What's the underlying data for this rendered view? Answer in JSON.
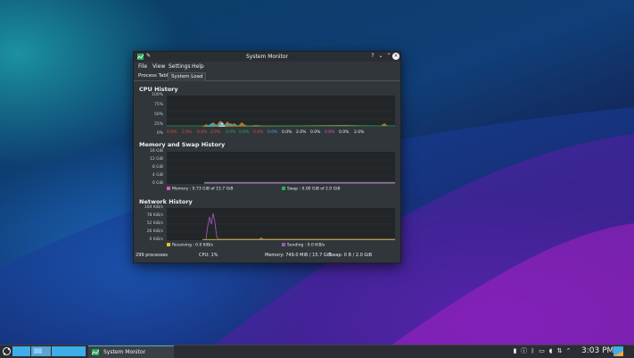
{
  "window": {
    "title": "System Monitor",
    "buttons": {
      "help": "?",
      "minimize": "⌄",
      "maximize": "⌃",
      "close": "×"
    }
  },
  "menu": [
    "File",
    "View",
    "Settings",
    "Help"
  ],
  "tabs": [
    {
      "label": "Process Table",
      "active": false
    },
    {
      "label": "System Load",
      "active": true
    }
  ],
  "cpu": {
    "title": "CPU History",
    "y_ticks": [
      "100%",
      "75%",
      "50%",
      "25%",
      "0%"
    ],
    "legend_values": [
      "0.0%",
      "2.0%",
      "0.0%",
      "2.0%",
      "0.0%",
      "0.0%",
      "0.0%",
      "0.0%",
      "0.0%",
      "2.0%",
      "0.0%",
      "0.0%",
      "0.0%",
      "2.0%"
    ],
    "legend_colors": [
      "#e74c3c",
      "#e74c3c",
      "#e74c3c",
      "#e74c3c",
      "#27ae60",
      "#27ae60",
      "#e74c3c",
      "#3daee9",
      "#eff0f1",
      "#eff0f1",
      "#eff0f1",
      "#e056c8",
      "#eff0f1",
      "#eff0f1"
    ]
  },
  "memory": {
    "title": "Memory and Swap History",
    "y_ticks": [
      "16 GiB",
      "12 GiB",
      "8 GiB",
      "4 GiB",
      "0 GiB"
    ],
    "memory_legend": "Memory : 0.73 GiB of 15.7 GiB",
    "swap_legend": "Swap : 0.00 GiB of 2.0 GiB",
    "memory_color": "#e056c8",
    "swap_color": "#27ae60"
  },
  "network": {
    "title": "Network History",
    "y_ticks": [
      "104 KiB/s",
      "78 KiB/s",
      "52 KiB/s",
      "26 KiB/s",
      "0 KiB/s"
    ],
    "receiving_legend": "Receiving : 0.0 KiB/s",
    "sending_legend": "Sending : 0.0 KiB/s",
    "receiving_color": "#d4c82a",
    "sending_color": "#9b59b6"
  },
  "status": {
    "processes": "299 processes",
    "cpu": "CPU: 1%",
    "memory": "Memory: 749.0 MiB / 15.7 GiB",
    "swap": "Swap: 0 B / 2.0 GiB"
  },
  "taskbar": {
    "task_label": "System Monitor",
    "clock": "3:03 PM"
  }
}
